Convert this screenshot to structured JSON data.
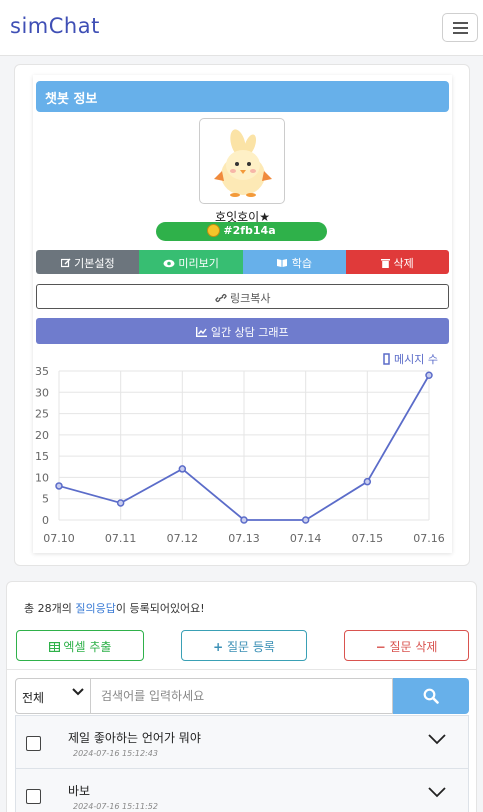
{
  "app": {
    "brand": "simChat"
  },
  "info": {
    "header": "챗봇 정보",
    "bot_name": "호잇호이★",
    "bot_id": "#2fb14a",
    "buttons": {
      "settings": "기본설정",
      "preview": "미리보기",
      "learn": "학습",
      "delete": "삭제"
    },
    "link_copy": "링크복사",
    "graph_button": "일간 상담 그래프"
  },
  "chart_data": {
    "type": "line",
    "legend": "메시지 수",
    "legend_position": "top-right",
    "categories": [
      "07.10",
      "07.11",
      "07.12",
      "07.13",
      "07.14",
      "07.15",
      "07.16"
    ],
    "series": [
      {
        "name": "메시지 수",
        "values": [
          8,
          4,
          12,
          0,
          0,
          9,
          34
        ],
        "color": "#5b6cc9"
      }
    ],
    "ylim": [
      0,
      35
    ],
    "yticks": [
      0,
      5,
      10,
      15,
      20,
      25,
      30,
      35
    ],
    "grid": true
  },
  "qa": {
    "summary_prefix": "총 28개의 ",
    "summary_highlight": "질의응답",
    "summary_suffix": "이 등록되어있어요!",
    "excel_button": "엑셀 추출",
    "add_button": "질문 등록",
    "delete_button": "질문 삭제",
    "filter_selected": "전체",
    "search_placeholder": "검색어를 입력하세요",
    "items": [
      {
        "question": "제일 좋아하는 언어가 뭐야",
        "timestamp": "2024-07-16 15:12:43"
      },
      {
        "question": "바보",
        "timestamp": "2024-07-16 15:11:52"
      }
    ]
  },
  "colors": {
    "brand": "#3f4fb5",
    "header_blue": "#67b0ea",
    "green": "#2fb14a",
    "red": "#e03a3a",
    "gray": "#6c757d",
    "purple": "#6f7ccd"
  }
}
